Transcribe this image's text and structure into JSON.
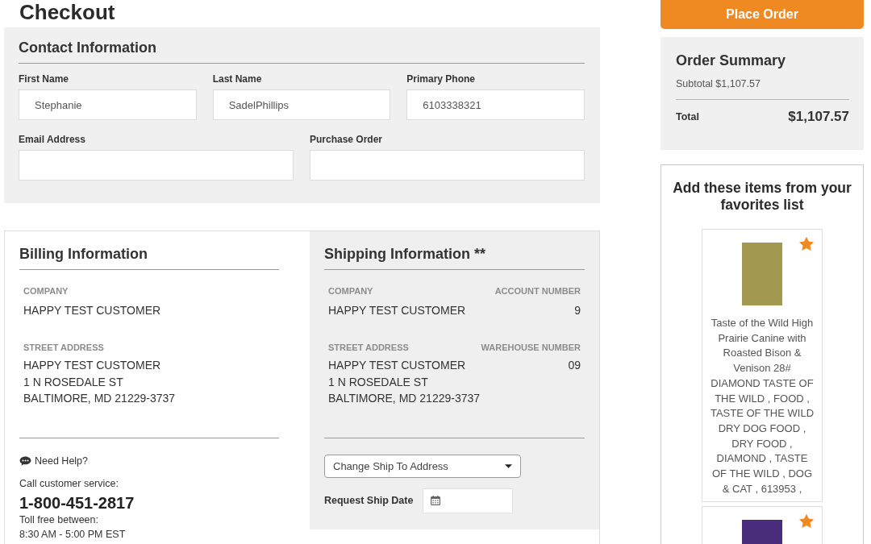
{
  "page": {
    "title": "Checkout"
  },
  "contact": {
    "title": "Contact Information",
    "rows": [
      [
        {
          "label": "First Name",
          "value": "Stephanie"
        },
        {
          "label": "Last Name",
          "value": "SadelPhillips"
        },
        {
          "label": "Primary Phone",
          "value": "6103338321"
        }
      ],
      [
        {
          "label": "Email Address"
        },
        {
          "label": "Purchase Order"
        }
      ]
    ]
  },
  "billing": {
    "title": "Billing Information",
    "company_label": "COMPANY",
    "company": "HAPPY TEST CUSTOMER",
    "street_label": "STREET ADDRESS",
    "street_lines": [
      "HAPPY TEST CUSTOMER",
      "1 N ROSEDALE ST",
      "BALTIMORE, MD 21229-3737"
    ]
  },
  "help": {
    "label": "Need Help?",
    "call_text": "Call customer service:",
    "phone": "1-800-451-2817",
    "toll_free": "Toll free between:",
    "hours": "8:30 AM - 5:00 PM EST"
  },
  "shipping": {
    "title": "Shipping Information **",
    "company_label": "COMPANY",
    "company": "HAPPY TEST CUSTOMER",
    "account_label": "ACCOUNT NUMBER",
    "account": "9",
    "street_label": "STREET ADDRESS",
    "street_lines": [
      "HAPPY TEST CUSTOMER",
      "1 N ROSEDALE ST",
      "BALTIMORE, MD 21229-3737"
    ],
    "warehouse_label": "WAREHOUSE NUMBER",
    "warehouse": "09",
    "ship_to_select": {
      "value": "Change Ship To Address"
    },
    "ship_date": {
      "label": "Request Ship Date"
    }
  },
  "order_summary": {
    "place_order_button": "Place Order",
    "title": "Order Summary",
    "subtotal": "Subtotal $1,107.57",
    "total_label": "Total",
    "total": "$1,107.57"
  },
  "favorites": {
    "title": "Add these items from your favorites list",
    "items": [
      {
        "name": "Taste of the Wild High Prairie Canine with Roasted Bison & Venison 28# DIAMOND TASTE OF THE WILD , FOOD , TASTE OF THE WILD DRY DOG FOOD , DRY FOOD , DIAMOND , TASTE OF THE WILD , DOG & CAT , 613953 ,",
        "favorite": true
      },
      {
        "favorite": true
      }
    ]
  }
}
